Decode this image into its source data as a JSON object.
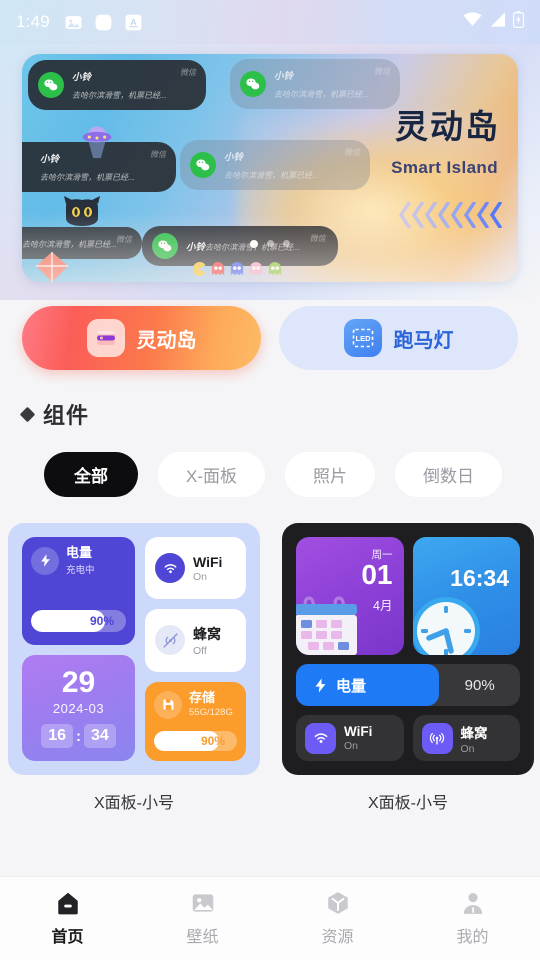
{
  "status_bar": {
    "time": "1:49",
    "left_icons": [
      "image-icon",
      "rounded-square-icon",
      "text-a-icon"
    ],
    "right_icons": [
      "wifi-icon",
      "cellular-signal-icon",
      "battery-charging-icon"
    ]
  },
  "banner": {
    "title": "灵动岛",
    "subtitle": "Smart Island",
    "notifications": [
      {
        "name": "小铃",
        "message": "去哈尔滨滑雪，机票已经...",
        "app": "微信"
      },
      {
        "name": "小铃",
        "message": "去哈尔滨滑雪，机票已经...",
        "app": "微信"
      },
      {
        "name": "小铃",
        "message": "去哈尔滨滑雪，机票已经...",
        "app": "微信"
      },
      {
        "name": "小铃",
        "message": "去哈尔滨滑雪，机票已经...",
        "app": "微信"
      },
      {
        "name": "小铃",
        "message": "去哈尔滨滑雪，机票已经...",
        "app": "微信"
      },
      {
        "name": "小铃",
        "message": "去哈尔滨滑雪，机票已经...",
        "app": "微信"
      }
    ],
    "accent_color": "#182642",
    "subtitle_color": "#3b4275"
  },
  "modes": [
    {
      "label": "灵动岛",
      "icon": "dynamic-island-icon",
      "active": true
    },
    {
      "label": "跑马灯",
      "icon": "led-marquee-icon",
      "active": false
    }
  ],
  "section": {
    "title": "组件"
  },
  "filter_chips": [
    {
      "label": "全部",
      "active": true
    },
    {
      "label": "X-面板",
      "active": false
    },
    {
      "label": "照片",
      "active": false
    },
    {
      "label": "倒数日",
      "active": false
    }
  ],
  "widgets": [
    {
      "label": "X面板-小号",
      "theme": "light",
      "battery": {
        "title": "电量",
        "status": "充电中",
        "percent": "90%"
      },
      "wifi": {
        "title": "WiFi",
        "status": "On"
      },
      "cellular": {
        "title": "蜂窝",
        "status": "Off"
      },
      "date": {
        "day": "29",
        "year_month": "2024-03",
        "hour": "16",
        "minute": "34",
        "separator": ":"
      },
      "storage": {
        "title": "存储",
        "detail": "55G/128G",
        "percent": "90%"
      }
    },
    {
      "label": "X面板-小号",
      "theme": "dark",
      "calendar": {
        "weekday": "周一",
        "day": "01",
        "month": "4月"
      },
      "clock": {
        "time": "16:34"
      },
      "battery": {
        "title": "电量",
        "percent": "90%"
      },
      "wifi": {
        "title": "WiFi",
        "status": "On"
      },
      "cellular": {
        "title": "蜂窝",
        "status": "On"
      }
    }
  ],
  "tabbar": [
    {
      "label": "首页",
      "icon": "home-icon",
      "active": true
    },
    {
      "label": "壁纸",
      "icon": "image-icon",
      "active": false
    },
    {
      "label": "资源",
      "icon": "cube-icon",
      "active": false
    },
    {
      "label": "我的",
      "icon": "person-icon",
      "active": false
    }
  ]
}
